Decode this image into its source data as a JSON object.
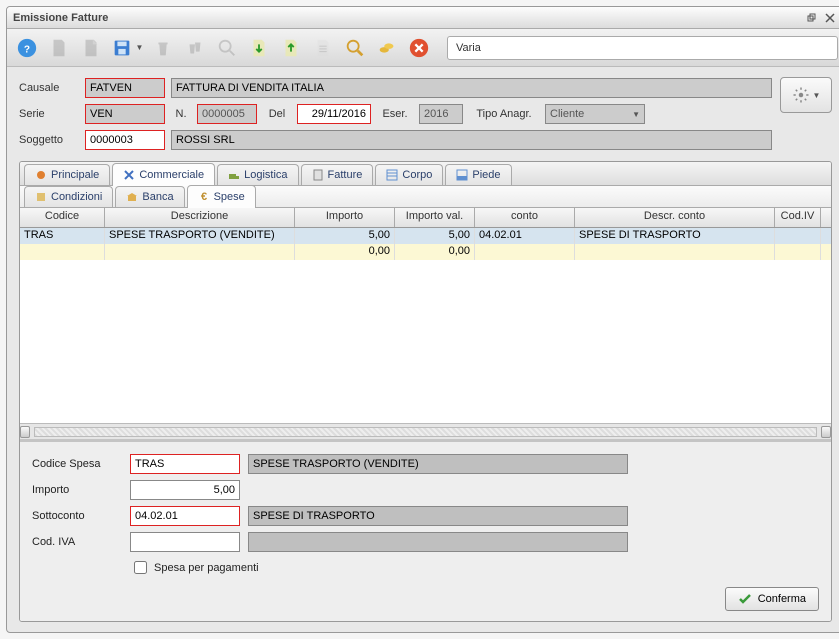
{
  "window": {
    "title": "Emissione Fatture"
  },
  "toolbar": {
    "status_text": "Varia"
  },
  "header": {
    "causale_label": "Causale",
    "causale_value": "FATVEN",
    "causale_descr": "FATTURA DI VENDITA ITALIA",
    "serie_label": "Serie",
    "serie_value": "VEN",
    "n_label": "N.",
    "n_value": "0000005",
    "del_label": "Del",
    "del_value": "29/11/2016",
    "eser_label": "Eser.",
    "eser_value": "2016",
    "tipo_anagr_label": "Tipo Anagr.",
    "tipo_anagr_value": "Cliente",
    "soggetto_label": "Soggetto",
    "soggetto_value": "0000003",
    "soggetto_descr": "ROSSI SRL"
  },
  "tabs": {
    "main": [
      "Principale",
      "Commerciale",
      "Logistica",
      "Fatture",
      "Corpo",
      "Piede"
    ],
    "sub": [
      "Condizioni",
      "Banca",
      "Spese"
    ]
  },
  "grid": {
    "headers": [
      "Codice",
      "Descrizione",
      "Importo",
      "Importo val.",
      "conto",
      "Descr. conto",
      "Cod.IV"
    ],
    "rows": [
      {
        "codice": "TRAS",
        "descr": "SPESE TRASPORTO (VENDITE)",
        "importo": "5,00",
        "importo_val": "5,00",
        "conto": "04.02.01",
        "descr_conto": "SPESE DI TRASPORTO",
        "codiv": ""
      },
      {
        "codice": "",
        "descr": "",
        "importo": "0,00",
        "importo_val": "0,00",
        "conto": "",
        "descr_conto": "",
        "codiv": ""
      }
    ]
  },
  "form": {
    "codice_spesa_label": "Codice Spesa",
    "codice_spesa_value": "TRAS",
    "codice_spesa_descr": "SPESE TRASPORTO (VENDITE)",
    "importo_label": "Importo",
    "importo_value": "5,00",
    "sottoconto_label": "Sottoconto",
    "sottoconto_value": "04.02.01",
    "sottoconto_descr": "SPESE DI TRASPORTO",
    "codiva_label": "Cod. IVA",
    "codiva_value": "",
    "codiva_descr": "",
    "spesa_pagamenti_label": "Spesa per pagamenti",
    "confirm_label": "Conferma"
  }
}
